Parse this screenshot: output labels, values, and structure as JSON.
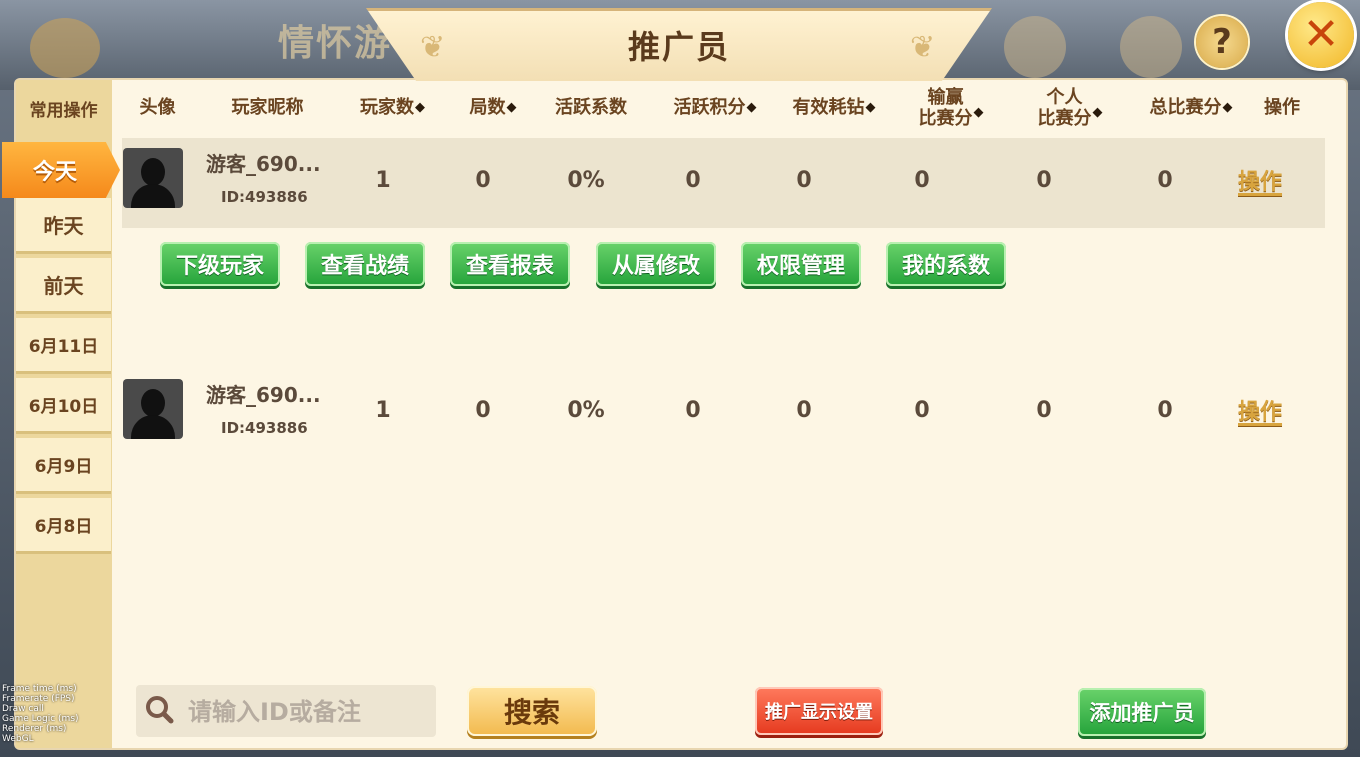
{
  "window": {
    "title": "推广员",
    "background_title": "情怀游"
  },
  "sidebar": {
    "header": "常用操作",
    "active": "今天",
    "items": [
      "昨天",
      "前天",
      "6月11日",
      "6月10日",
      "6月9日",
      "6月8日"
    ]
  },
  "table": {
    "headers": {
      "avatar": "头像",
      "nickname": "玩家昵称",
      "players": "玩家数",
      "rounds": "局数",
      "activity_ratio": "活跃系数",
      "activity_points": "活跃积分",
      "valid_diamonds": "有效耗钻",
      "winloss_1": "输赢",
      "winloss_2": "比赛分",
      "personal_1": "个人",
      "personal_2": "比赛分",
      "total_score": "总比赛分",
      "action": "操作"
    },
    "sort_glyph": "◆",
    "rows": [
      {
        "nickname": "游客_690...",
        "id": "ID:493886",
        "players": "1",
        "rounds": "0",
        "activity_ratio": "0%",
        "activity_points": "0",
        "valid_diamonds": "0",
        "winloss_score": "0",
        "personal_score": "0",
        "total_score": "0",
        "action": "操作"
      },
      {
        "nickname": "游客_690...",
        "id": "ID:493886",
        "players": "1",
        "rounds": "0",
        "activity_ratio": "0%",
        "activity_points": "0",
        "valid_diamonds": "0",
        "winloss_score": "0",
        "personal_score": "0",
        "total_score": "0",
        "action": "操作"
      }
    ]
  },
  "row_actions": [
    "下级玩家",
    "查看战绩",
    "查看报表",
    "从属修改",
    "权限管理",
    "我的系数"
  ],
  "bottom": {
    "search_placeholder": "请输入ID或备注",
    "search_button": "搜索",
    "display_settings_button": "推广显示设置",
    "add_promoter_button": "添加推广员"
  },
  "icons": {
    "help": "?",
    "close": "✕",
    "back": "back-arrow-icon"
  },
  "debug_overlay": [
    "Frame time (ms)",
    "Framerate (FPS)",
    "Draw call",
    "Game Logic (ms)",
    "Renderer (ms)",
    "WebGL"
  ],
  "colors": {
    "panel_bg": "#fdf6e4",
    "header_text": "#6a4420",
    "active_tab": "#f5891b",
    "green_button": "#24a33a",
    "red_button": "#e5391e",
    "yellow_button": "#f2b94d"
  }
}
